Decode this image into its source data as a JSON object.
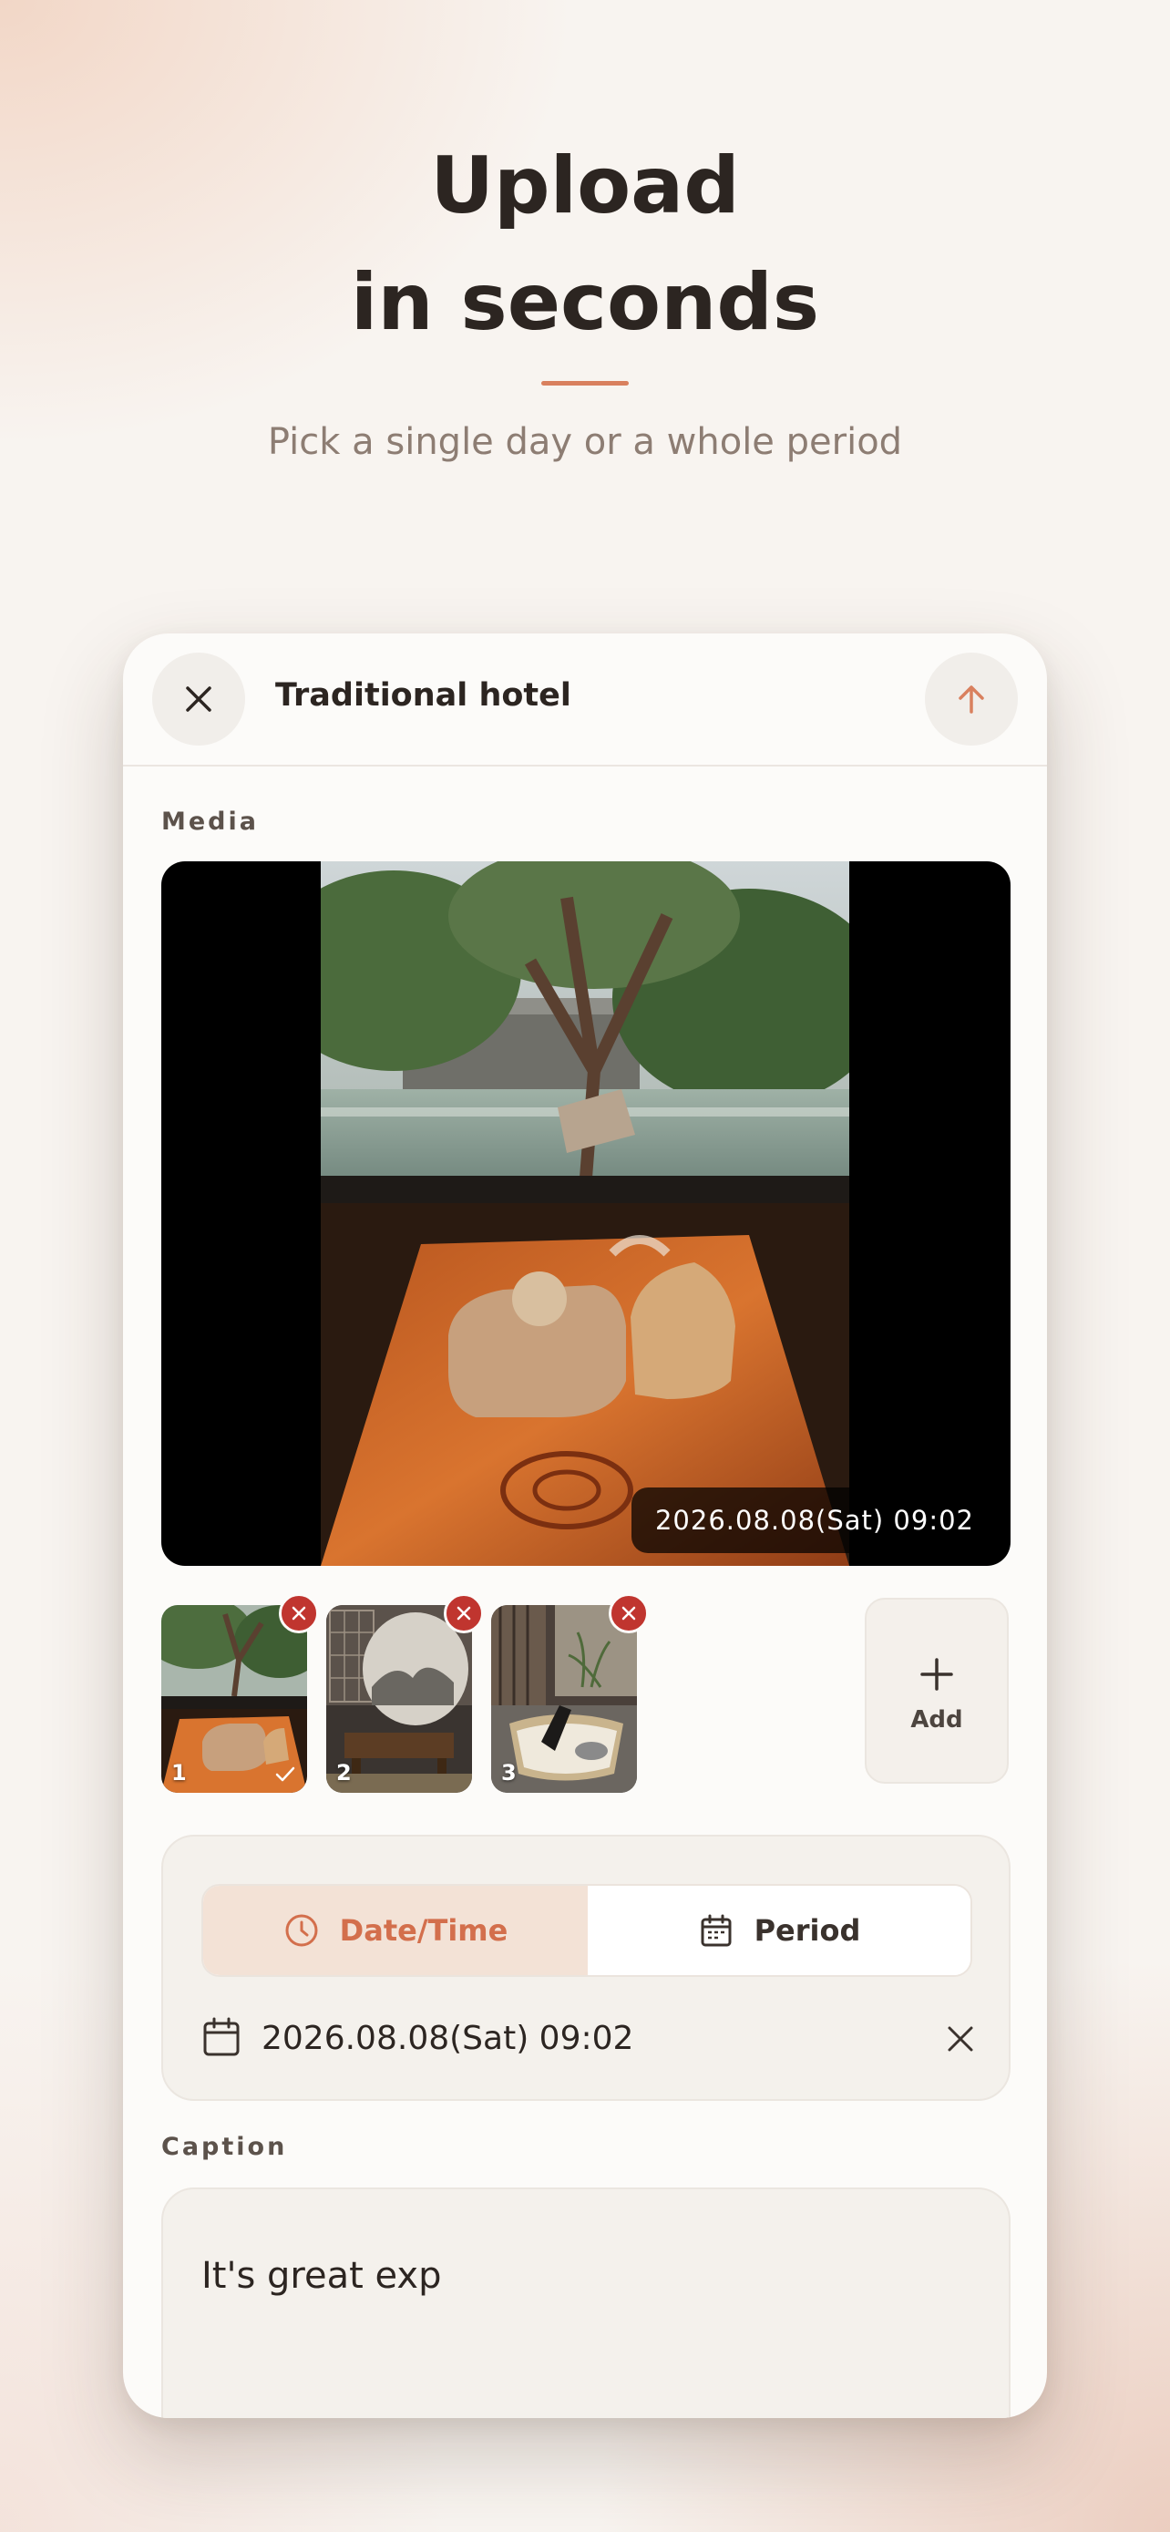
{
  "hero": {
    "title_line1": "Upload",
    "title_line2": "in seconds",
    "subtitle": "Pick a single day or a whole period"
  },
  "header": {
    "title": "Traditional hotel",
    "close_icon": "close-icon",
    "upload_icon": "arrow-up-icon"
  },
  "media": {
    "label": "Media",
    "selected_timestamp": "2026.08.08(Sat) 09:02",
    "thumbnails": [
      {
        "number": "1",
        "selected": true
      },
      {
        "number": "2",
        "selected": false
      },
      {
        "number": "3",
        "selected": false
      }
    ],
    "add_label": "Add"
  },
  "date": {
    "tabs": [
      {
        "label": "Date/Time",
        "icon": "clock-icon",
        "active": true
      },
      {
        "label": "Period",
        "icon": "calendar-icon",
        "active": false
      }
    ],
    "value": "2026.08.08(Sat) 09:02"
  },
  "caption": {
    "label": "Caption",
    "value": "It's great exp"
  },
  "colors": {
    "accent": "#d9805e",
    "accent_text": "#d36f4c",
    "remove_badge": "#c0352f",
    "text_dark": "#2c2521"
  }
}
